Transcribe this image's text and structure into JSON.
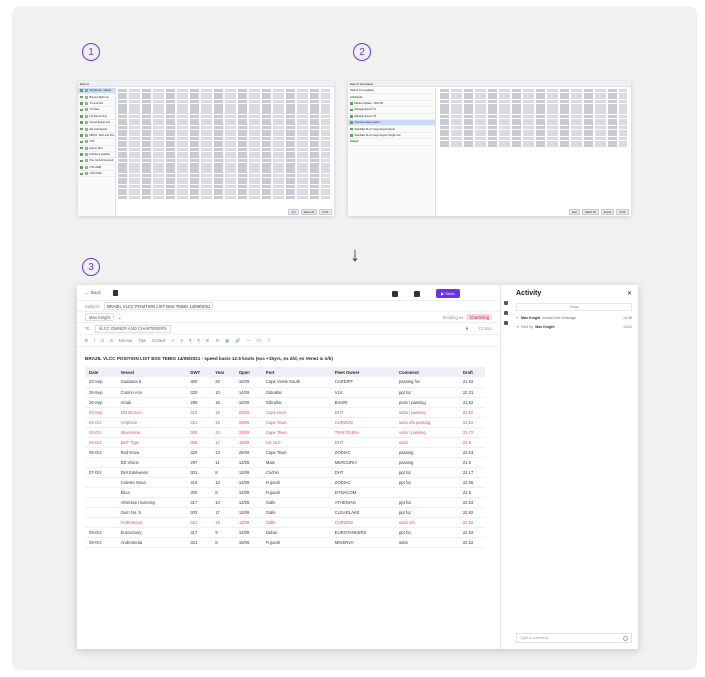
{
  "steps": [
    "1",
    "2",
    "3"
  ],
  "arrow": "↓",
  "colors": {
    "accent": "#6a35e8",
    "alert_red": "#e2486f",
    "faded_pink": "#f0a0b8"
  },
  "export_window": {
    "title": "Export",
    "items": [
      "Simple list - Owner",
      "Bounce Mail List",
      "TC and Pos",
      "TC Dass",
      "Fat Name Only",
      "Period Export List",
      "Ale Last Export",
      "DRCO: Tech and Pos",
      "OTA",
      "Export Test",
      "Full Exec position",
      "Pos. list b/d licensed",
      "OTA 1998",
      "OTA OVAF"
    ],
    "footer_buttons": [
      "A-Z",
      "Select All",
      "XCVL"
    ]
  },
  "templates_window": {
    "title": "Export Templates",
    "search": "Search for templates",
    "group": "Ardahaube",
    "items": [
      "Market Update - VM+TM",
      "Manage Export TC",
      "Manage Export VS",
      "One-line cargo export",
      "Stanbiker M+C Cargo Export Excel",
      "Stanbiker M+C Cargo Export Single row"
    ],
    "group2": "Default",
    "footer_buttons": [
      "New",
      "Select All",
      "Export",
      "XCVL"
    ]
  },
  "composer": {
    "back": "← Back",
    "send": "▶ Send",
    "subject_label": "Subject:",
    "subject": "BRAZIL VLCC POSITION LIST BSS TEBIG 14/09/2021",
    "from": "Max Knight",
    "sending_as_label": "Sending as",
    "sending_as": "Chartering",
    "to_label": "To:",
    "to": "VLCC OWNER AND CHARTERERS",
    "cc": "Cc  Bcc",
    "toolbar": [
      "B",
      "I",
      "U",
      "S",
      "Normal",
      "Tipe",
      "Default",
      "A",
      "A",
      "¶",
      "¶",
      "☰",
      "☰",
      "▦",
      "🔗",
      "—",
      "<>",
      "≡"
    ],
    "heading": "BRAZIL VLCC POSITION LIST BSS TEBIG 14/09/2021 - speed basis 12.5 knots (exc +15yrs, ex d/d, ex Venez & n/b)",
    "columns": [
      "Date",
      "Vessel",
      "DWT",
      "Year",
      "Open",
      "Port",
      "Fleet Owner",
      "Comment",
      "Draft"
    ],
    "rows": [
      {
        "date": "23-Sep",
        "vessel": "Guatania 5",
        "dwt": "300",
        "year": "20",
        "open": "10/09",
        "port": "Cape Verde South",
        "owner": "CARDIFF",
        "comment": "passing foc",
        "draft": "21.62",
        "style": ""
      },
      {
        "date": "26-Sep",
        "vessel": "Cosmo Ace",
        "dwt": "320",
        "year": "10",
        "open": "14/09",
        "port": "Gibraltar",
        "owner": "VLS",
        "comment": "ppt foc",
        "draft": "22.31",
        "style": ""
      },
      {
        "date": "26-Sep",
        "vessel": "Amali",
        "dwt": "299",
        "year": "16",
        "open": "16/09",
        "port": "Gibraltar",
        "owner": "BAHRI",
        "comment": "poss / passing",
        "draft": "21.62",
        "style": ""
      },
      {
        "date": "29-Sep",
        "vessel": "Dht Bronco",
        "dwt": "318",
        "year": "15",
        "open": "23/09",
        "port": "Cape Horn",
        "owner": "DHT",
        "comment": "subs / passing",
        "draft": "22.52",
        "style": "red"
      },
      {
        "date": "02-Oct",
        "vessel": "Amphion",
        "dwt": "321",
        "year": "15",
        "open": "23/09",
        "port": "Cape Town",
        "owner": "CURZON",
        "comment": "subs o/b passing",
        "draft": "22.52",
        "style": "red"
      },
      {
        "date": "03-Oct",
        "vessel": "Silvermine",
        "dwt": "300",
        "year": "23",
        "open": "23/09",
        "port": "Cape Town",
        "owner": "TRAFIGURA",
        "comment": "subs / passing",
        "draft": "21.72",
        "style": "red"
      },
      {
        "date": "04-Oct",
        "vessel": "DHT Tiger",
        "dwt": "306",
        "year": "17",
        "open": "19/09",
        "port": "US GLF",
        "owner": "DHT",
        "comment": "subs",
        "draft": "21.6",
        "style": "red"
      },
      {
        "date": "06-Oct",
        "vessel": "Red Nova",
        "dwt": "320",
        "year": "13",
        "open": "26/09",
        "port": "Cape Town",
        "owner": "ZODIAC",
        "comment": "passing",
        "draft": "22.63",
        "style": ""
      },
      {
        "date": "",
        "vessel": "DS Vision",
        "dwt": "297",
        "year": "11",
        "open": "13/09",
        "port": "Male",
        "owner": "MERCURIA",
        "comment": "passing",
        "draft": "21.5",
        "style": ""
      },
      {
        "date": "07-Oct",
        "vessel": "DHI Edelweiss",
        "dwt": "301",
        "year": "8",
        "open": "13/09",
        "port": "Cochin",
        "owner": "DHT",
        "comment": "ppt foc",
        "draft": "22.17",
        "style": ""
      },
      {
        "date": "",
        "vessel": "Celeste Nova",
        "dwt": "319",
        "year": "13",
        "open": "13/09",
        "port": "Fujurah",
        "owner": "ZODIAC",
        "comment": "ppt foc",
        "draft": "22.66",
        "style": ""
      },
      {
        "date": "",
        "vessel": "Elica",
        "dwt": "300",
        "year": "8",
        "open": "13/09",
        "port": "Fujurah",
        "owner": "DYNACOM",
        "comment": "",
        "draft": "21.5",
        "style": ""
      },
      {
        "date": "",
        "vessel": "Athenian Harmony",
        "dwt": "317",
        "year": "10",
        "open": "13/09",
        "port": "Galle",
        "owner": "ATHENIAN",
        "comment": "ppt foc",
        "draft": "22.63",
        "style": ""
      },
      {
        "date": "",
        "vessel": "Gem No. 5",
        "dwt": "303",
        "year": "17",
        "open": "13/09",
        "port": "Galle",
        "owner": "CLEARLAKE",
        "comment": "ppt foc",
        "draft": "22.82",
        "style": ""
      },
      {
        "date": "",
        "vessel": "Andromeus",
        "dwt": "321",
        "year": "18",
        "open": "13/09",
        "port": "Galle",
        "owner": "CURZON",
        "comment": "subs o/b",
        "draft": "22.52",
        "style": "red"
      },
      {
        "date": "08-Oct",
        "vessel": "Eurovictory",
        "dwt": "317",
        "year": "9",
        "open": "13/09",
        "port": "Dubai",
        "owner": "EUROTANKERS",
        "comment": "ppt foc",
        "draft": "22.52",
        "style": ""
      },
      {
        "date": "09-Oct",
        "vessel": "Andromeda",
        "dwt": "321",
        "year": "8",
        "open": "15/09",
        "port": "Fujurah",
        "owner": "MINERVA",
        "comment": "subs",
        "draft": "22.52",
        "style": ""
      }
    ]
  },
  "activity": {
    "title": "Activity",
    "close": "✕",
    "today": "Today",
    "events": [
      {
        "who": "Max Knight",
        "text": "created the message",
        "time": "14:38"
      },
      {
        "who": "Max Knight",
        "text": "Sent by",
        "time": "14:51"
      }
    ],
    "comment_placeholder": "Type a comment"
  }
}
